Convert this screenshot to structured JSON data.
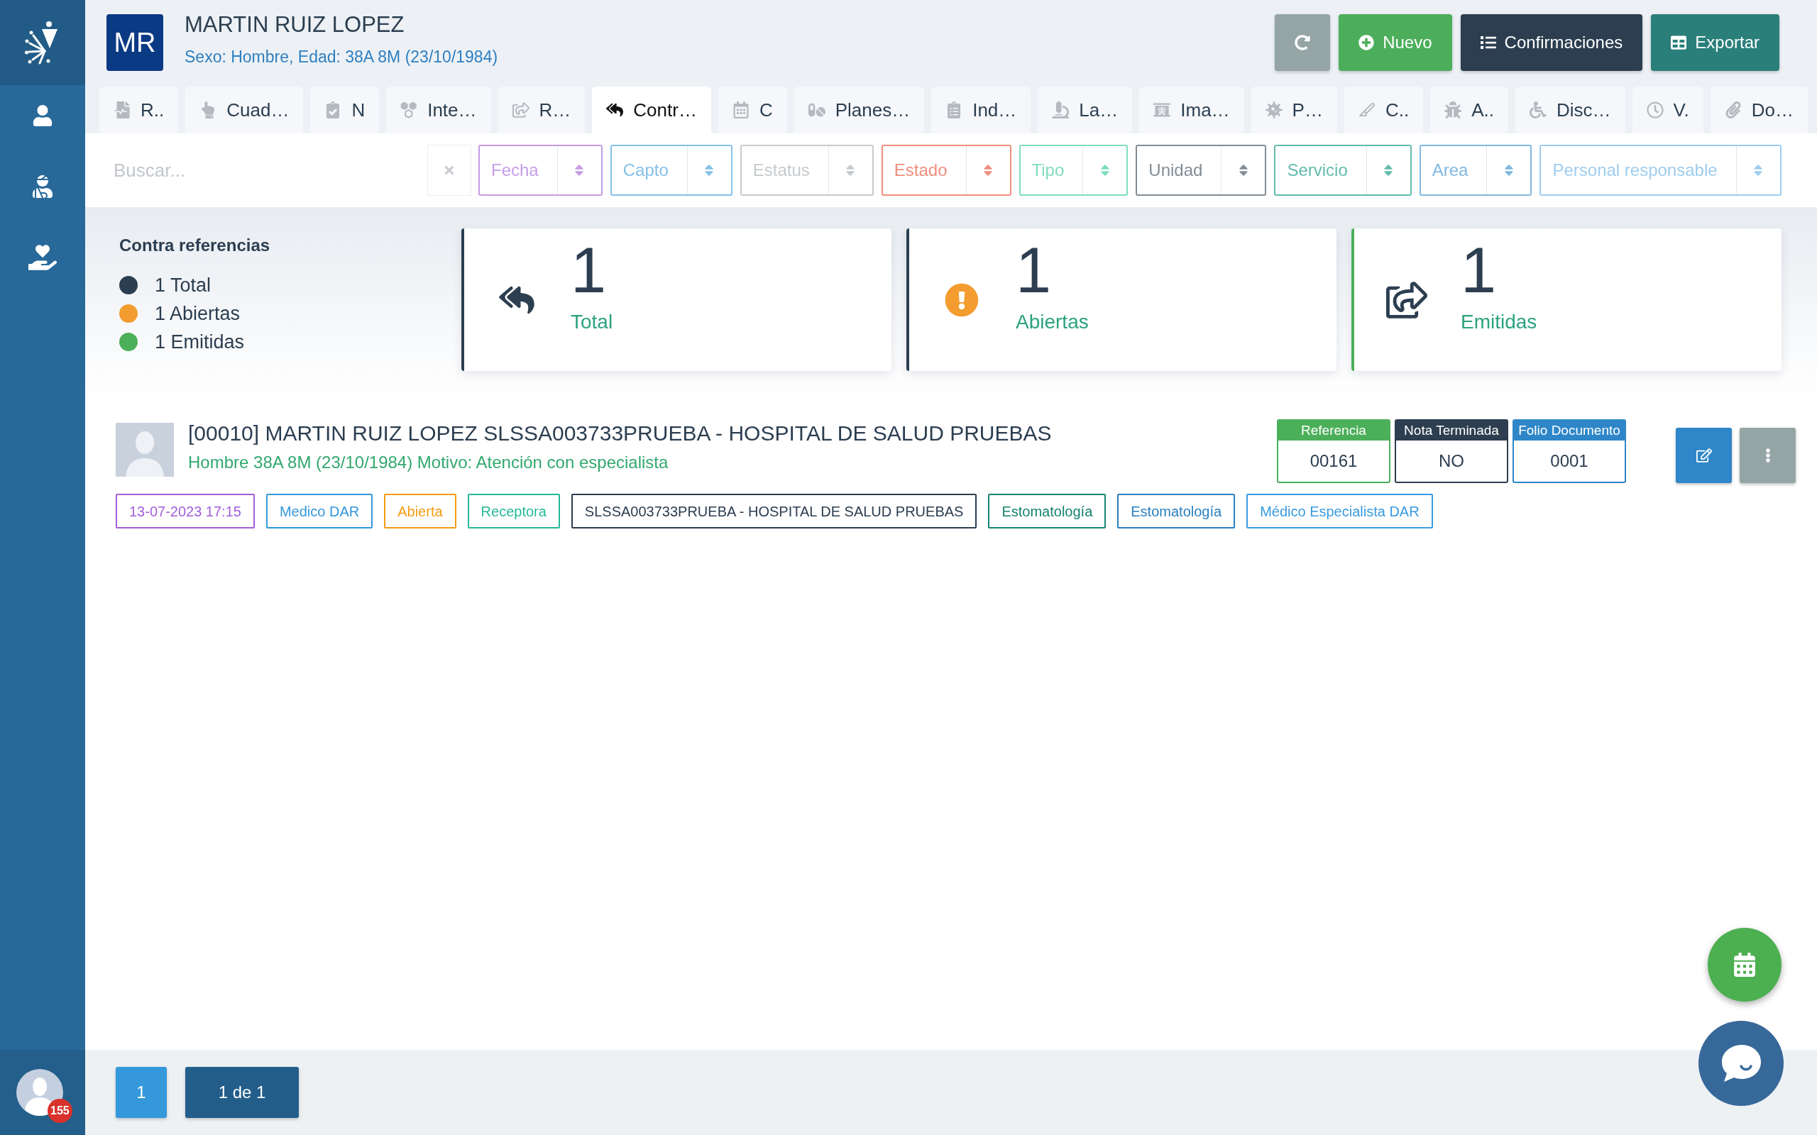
{
  "patient": {
    "initials": "MR",
    "name": "MARTIN RUIZ LOPEZ",
    "details": "Sexo: Hombre, Edad: 38A 8M (23/10/1984)"
  },
  "header_buttons": [
    {
      "kind": "new",
      "label": "Nuevo"
    },
    {
      "kind": "confirmations",
      "label": "Confirmaciones"
    },
    {
      "kind": "export",
      "label": "Exportar"
    }
  ],
  "tabs": [
    {
      "label": "R..",
      "selected": false
    },
    {
      "label": "Cuad…",
      "selected": false
    },
    {
      "label": "N",
      "selected": false
    },
    {
      "label": "Inte…",
      "selected": false
    },
    {
      "label": "R…",
      "selected": false
    },
    {
      "label": "Contr…",
      "selected": true
    },
    {
      "label": "C",
      "selected": false
    },
    {
      "label": "Planes…",
      "selected": false
    },
    {
      "label": "Ind…",
      "selected": false
    },
    {
      "label": "La…",
      "selected": false
    },
    {
      "label": "Ima…",
      "selected": false
    },
    {
      "label": "P…",
      "selected": false
    },
    {
      "label": "C..",
      "selected": false
    },
    {
      "label": "A..",
      "selected": false
    },
    {
      "label": "Disc…",
      "selected": false
    },
    {
      "label": "V.",
      "selected": false
    },
    {
      "label": "Do…",
      "selected": false
    }
  ],
  "search": {
    "placeholder": "Buscar..."
  },
  "filters": [
    {
      "placeholder": "Fecha",
      "color": "#c59de6"
    },
    {
      "placeholder": "Capto",
      "color": "#85c1ea"
    },
    {
      "placeholder": "Estatus",
      "color": "#c6cacd"
    },
    {
      "placeholder": "Estado",
      "color": "#f08e7e"
    },
    {
      "placeholder": "Tipo",
      "color": "#7fdcc0"
    },
    {
      "placeholder": "Unidad",
      "color": "#838d95"
    },
    {
      "placeholder": "Servicio",
      "color": "#62bcae"
    },
    {
      "placeholder": "Area",
      "color": "#80b8e0"
    },
    {
      "placeholder": "Personal responsable",
      "color": "#9fcdef"
    }
  ],
  "summary": {
    "title": "Contra referencias",
    "legend": [
      {
        "label": "1 Total",
        "color": "#2c3e50"
      },
      {
        "label": "1 Abiertas",
        "color": "#f39c2f"
      },
      {
        "label": "1 Emitidas",
        "color": "#4caf5a"
      }
    ],
    "cards": [
      {
        "kind": "total",
        "value": "1",
        "label": "Total",
        "color": "#2c3e50"
      },
      {
        "kind": "open",
        "value": "1",
        "label": "Abiertas",
        "color": "#2c3e50"
      },
      {
        "kind": "issued",
        "value": "1",
        "label": "Emitidas",
        "color": "#4caf5a"
      }
    ]
  },
  "records": [
    {
      "title": "[00010] MARTIN RUIZ LOPEZ SLSSA003733PRUEBA - HOSPITAL DE SALUD PRUEBAS",
      "subtitle": "Hombre 38A 8M (23/10/1984) Motivo: Atención con especialista",
      "fields": [
        {
          "label": "Referencia",
          "value": "00161",
          "color": "#4caf5a"
        },
        {
          "label": "Nota Terminada",
          "value": "NO",
          "color": "#2c3e50"
        },
        {
          "label": "Folio Documento",
          "value": "0001",
          "color": "#2e86c8"
        }
      ],
      "tags": [
        {
          "label": "13-07-2023 17:15",
          "color": "#a45fd9"
        },
        {
          "label": "Medico DAR",
          "color": "#3498db"
        },
        {
          "label": "Abierta",
          "color": "#f39c12"
        },
        {
          "label": "Receptora",
          "color": "#26b99a"
        },
        {
          "label": "SLSSA003733PRUEBA - HOSPITAL DE SALUD PRUEBAS",
          "color": "#2c3e50"
        },
        {
          "label": "Estomatología",
          "color": "#16836f"
        },
        {
          "label": "Estomatología",
          "color": "#2a7fbf"
        },
        {
          "label": "Médico Especialista DAR",
          "color": "#3a9be0"
        }
      ]
    }
  ],
  "pagination": {
    "page": "1",
    "summary": "1 de 1"
  },
  "user": {
    "notifications": "155"
  }
}
